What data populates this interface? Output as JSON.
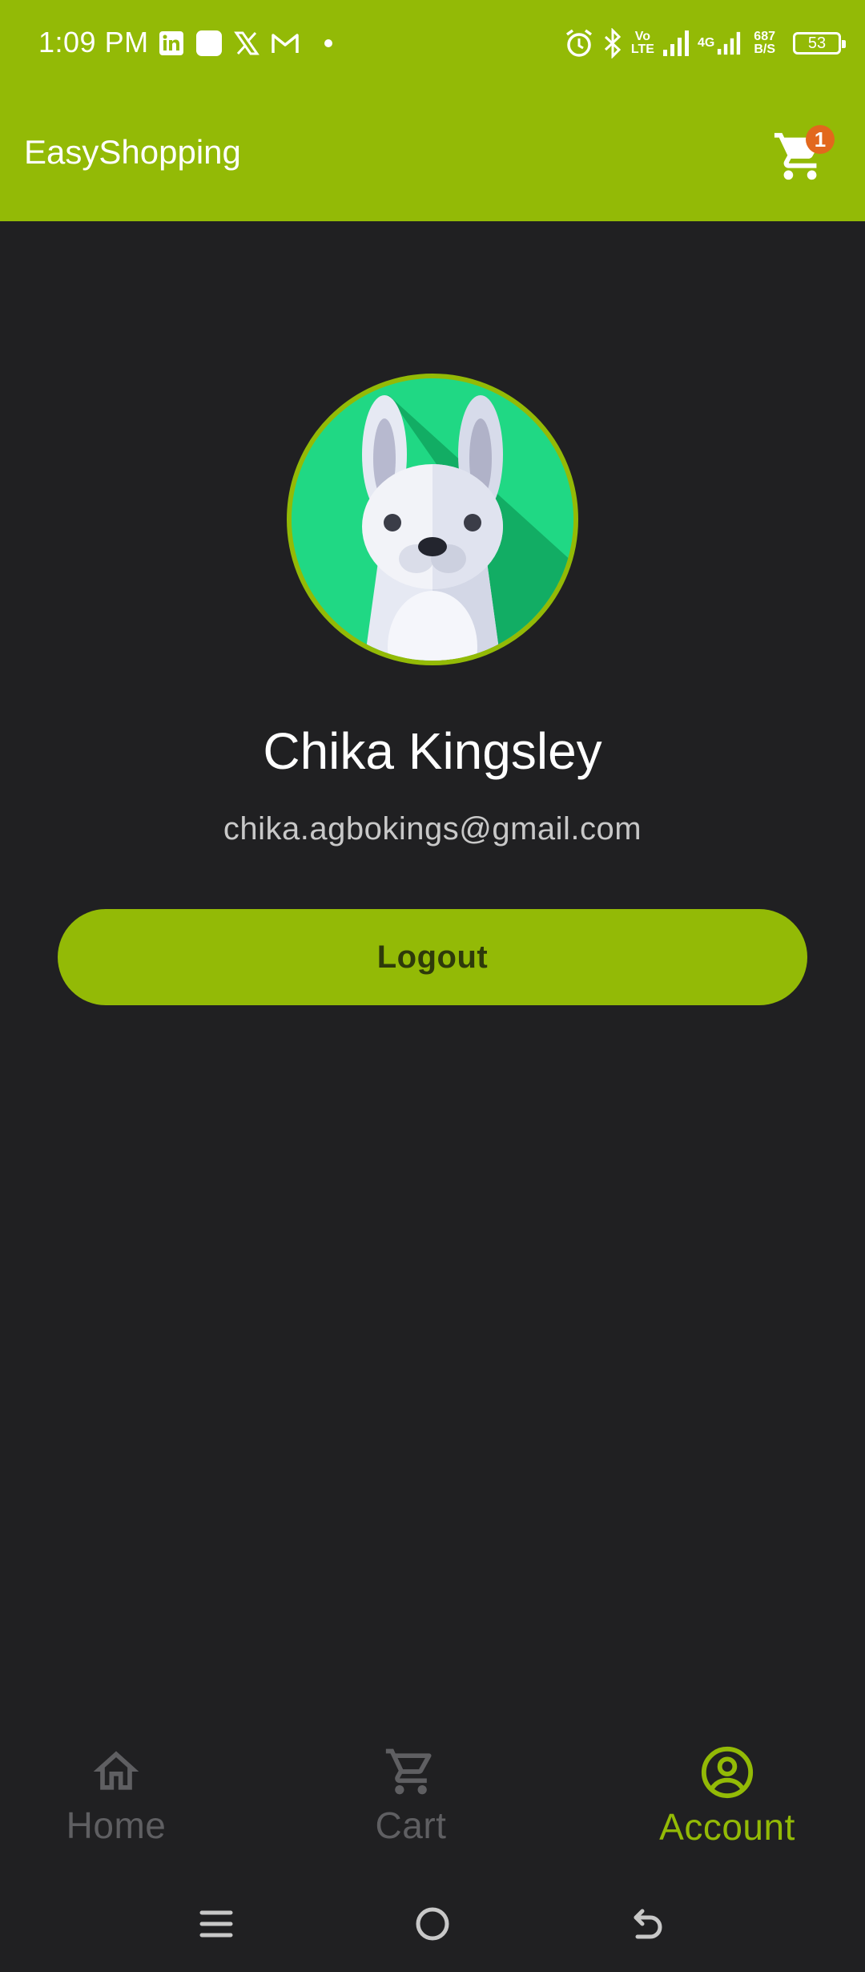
{
  "status_bar": {
    "time": "1:09 PM",
    "left_icons": [
      "linkedin-icon",
      "app-square-icon",
      "x-icon",
      "gmail-icon",
      "dot-icon"
    ],
    "right_icons": [
      "alarm-icon",
      "bluetooth-icon",
      "volte-icon",
      "signal-icon",
      "4g-signal-icon"
    ],
    "volte_top": "Vo",
    "volte_bottom": "LTE",
    "net_type": "4G",
    "speed_value": "687",
    "speed_unit": "B/S",
    "battery": "53"
  },
  "app_bar": {
    "title": "EasyShopping",
    "cart_badge": "1",
    "brand_color": "#93ba06",
    "badge_color": "#e2681d"
  },
  "profile": {
    "name": "Chika Kingsley",
    "email": "chika.agbokings@gmail.com",
    "avatar_icon": "rabbit-avatar-icon"
  },
  "actions": {
    "logout_label": "Logout"
  },
  "bottom_nav": {
    "items": [
      {
        "label": "Home",
        "icon": "home-icon",
        "active": false
      },
      {
        "label": "Cart",
        "icon": "cart-icon",
        "active": false
      },
      {
        "label": "Account",
        "icon": "account-icon",
        "active": true
      }
    ],
    "active_color": "#93ba06",
    "inactive_color": "#5f5f62"
  },
  "system_nav": [
    "menu-icon",
    "home-circle-icon",
    "back-icon"
  ]
}
